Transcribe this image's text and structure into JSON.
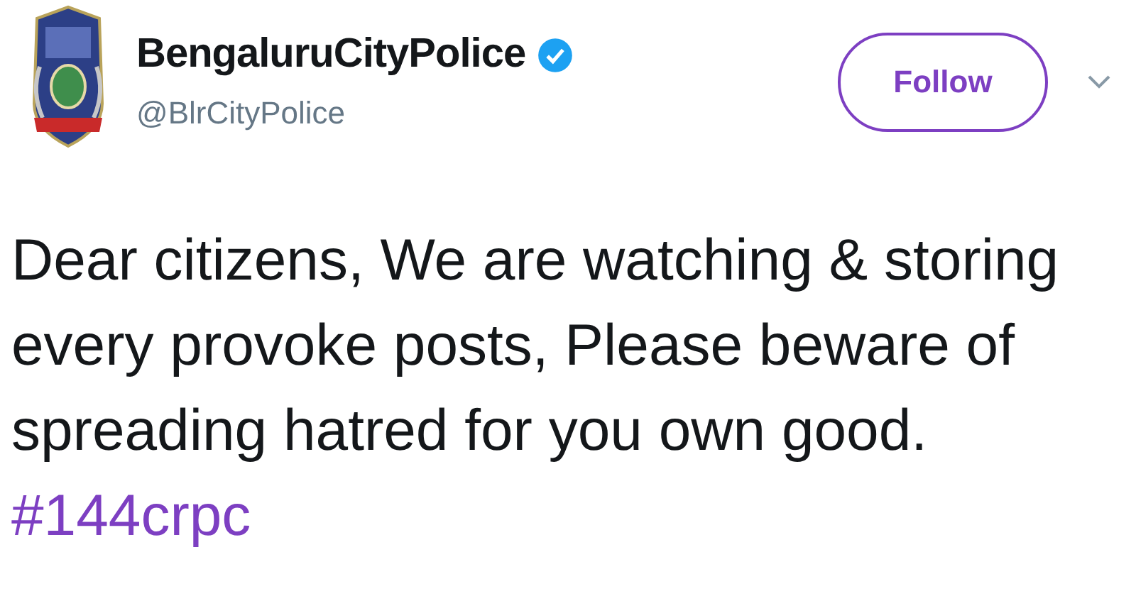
{
  "account": {
    "name": "BengaluruCityPolice",
    "verified": true,
    "handle": "@BlrCityPolice"
  },
  "follow_button": {
    "label": "Follow"
  },
  "tweet": {
    "text": "Dear citizens, We are watching & storing every provoke posts, Please beware of spreading hatred for you own good. ",
    "hashtag": "#144crpc"
  }
}
